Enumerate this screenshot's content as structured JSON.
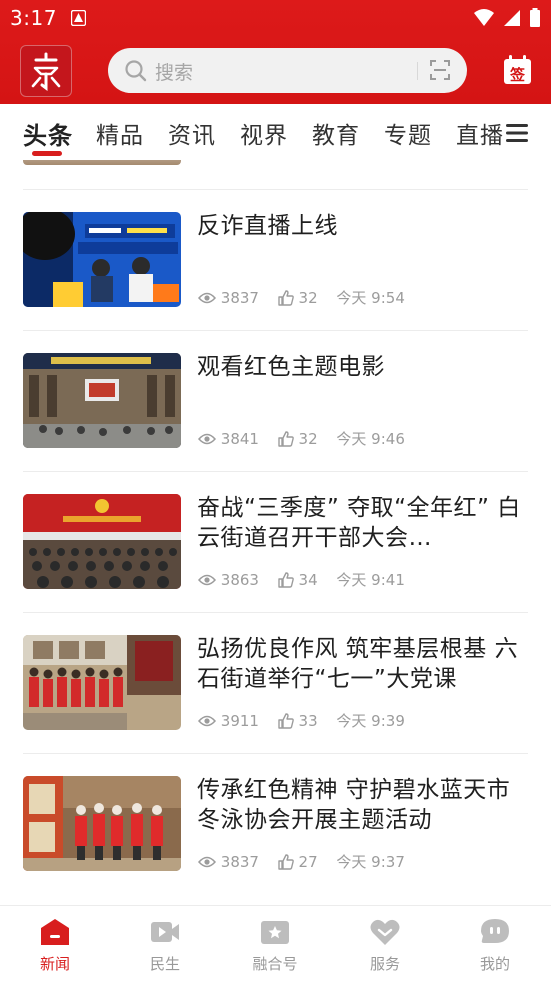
{
  "status_bar": {
    "time": "3:17"
  },
  "header": {
    "search_placeholder": "搜索",
    "signin_label": "签"
  },
  "tabs": [
    {
      "label": "头条",
      "active": true
    },
    {
      "label": "精品"
    },
    {
      "label": "资讯"
    },
    {
      "label": "视界"
    },
    {
      "label": "教育"
    },
    {
      "label": "专题"
    },
    {
      "label": "直播"
    }
  ],
  "feed": {
    "items": [
      {
        "title": "反诈直播上线",
        "views": "3837",
        "likes": "32",
        "time": "今天 9:54"
      },
      {
        "title": "观看红色主题电影",
        "views": "3841",
        "likes": "32",
        "time": "今天 9:46"
      },
      {
        "title": "奋战“三季度” 夺取“全年红” 白云街道召开干部大会…",
        "views": "3863",
        "likes": "34",
        "time": "今天 9:41"
      },
      {
        "title": "弘扬优良作风 筑牢基层根基 六石街道举行“七一”大党课",
        "views": "3911",
        "likes": "33",
        "time": "今天 9:39"
      },
      {
        "title": "传承红色精神 守护碧水蓝天市冬泳协会开展主题活动",
        "views": "3837",
        "likes": "27",
        "time": "今天 9:37"
      }
    ]
  },
  "bottom_nav": [
    {
      "label": "新闻",
      "icon": "news-icon",
      "active": true
    },
    {
      "label": "民生",
      "icon": "video-icon"
    },
    {
      "label": "融合号",
      "icon": "star-badge-icon"
    },
    {
      "label": "服务",
      "icon": "heart-icon"
    },
    {
      "label": "我的",
      "icon": "chat-face-icon"
    }
  ],
  "colors": {
    "brand": "#d81e1e",
    "meta": "#9c9c9c"
  }
}
